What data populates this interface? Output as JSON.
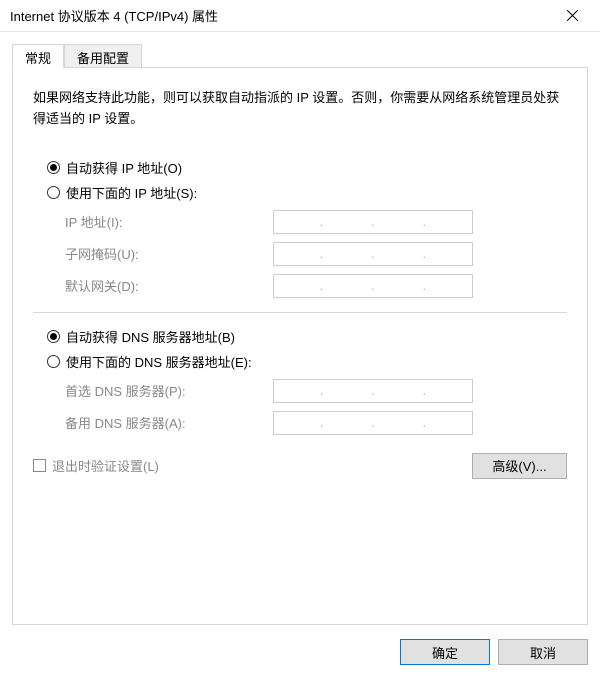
{
  "window": {
    "title": "Internet 协议版本 4 (TCP/IPv4) 属性"
  },
  "tabs": {
    "general": "常规",
    "alternate": "备用配置"
  },
  "description": "如果网络支持此功能，则可以获取自动指派的 IP 设置。否则，你需要从网络系统管理员处获得适当的 IP 设置。",
  "ip": {
    "auto_label": "自动获得 IP 地址(O)",
    "manual_label": "使用下面的 IP 地址(S):",
    "selected": "auto",
    "fields": {
      "ip_address": "IP 地址(I):",
      "subnet_mask": "子网掩码(U):",
      "default_gateway": "默认网关(D):"
    }
  },
  "dns": {
    "auto_label": "自动获得 DNS 服务器地址(B)",
    "manual_label": "使用下面的 DNS 服务器地址(E):",
    "selected": "auto",
    "fields": {
      "preferred": "首选 DNS 服务器(P):",
      "alternate": "备用 DNS 服务器(A):"
    }
  },
  "validate_on_exit": {
    "label": "退出时验证设置(L)",
    "checked": false
  },
  "buttons": {
    "advanced": "高级(V)...",
    "ok": "确定",
    "cancel": "取消"
  }
}
